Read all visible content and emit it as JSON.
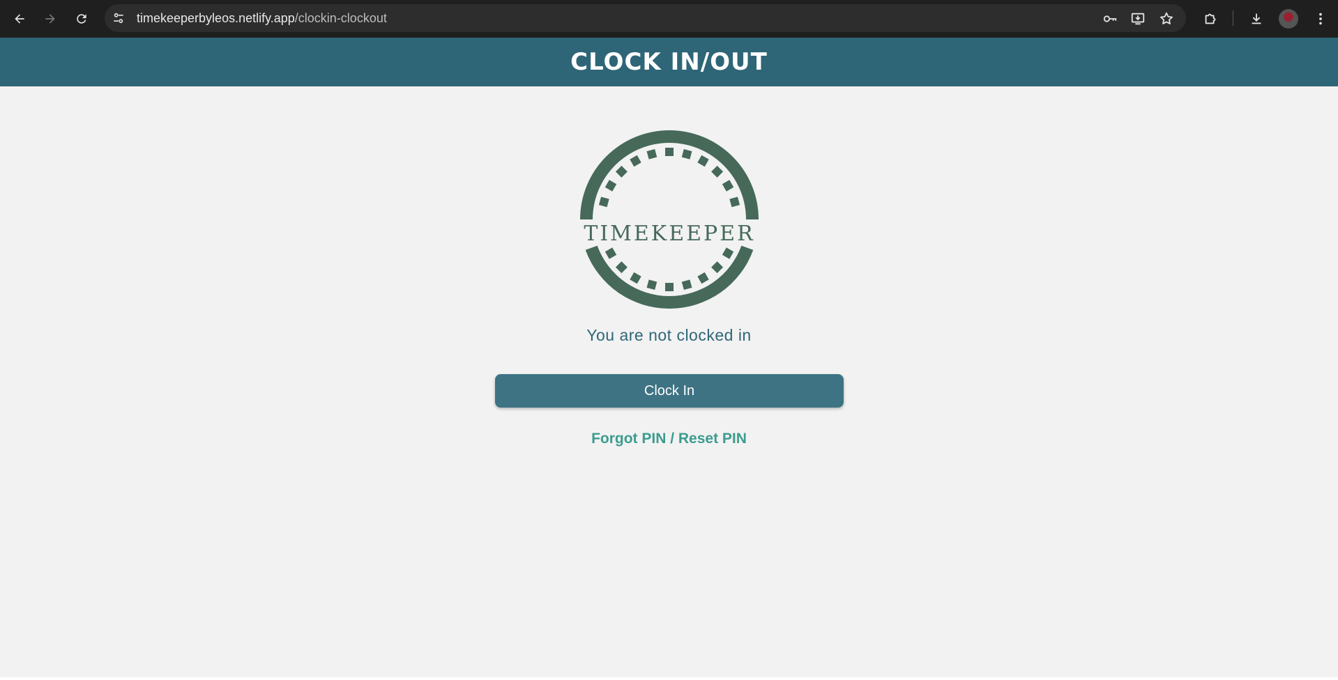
{
  "browser": {
    "url_host": "timekeeperbyleos.netlify.app",
    "url_path": "/clockin-clockout",
    "back_icon": "arrow-left-icon",
    "forward_icon": "arrow-right-icon",
    "reload_icon": "reload-icon",
    "site_info_icon": "tune-icon",
    "password_icon": "key-icon",
    "install_icon": "install-app-icon",
    "bookmark_icon": "star-icon",
    "extensions_icon": "puzzle-icon",
    "downloads_icon": "download-icon",
    "menu_icon": "more-vert-icon"
  },
  "header": {
    "title": "CLOCK IN/OUT",
    "background": "#2e6677"
  },
  "logo": {
    "text": "TIMEKEEPER",
    "color": "#46695a"
  },
  "main": {
    "status": "You are not clocked in",
    "clock_button_label": "Clock In",
    "forgot_link_label": "Forgot PIN / Reset PIN"
  },
  "colors": {
    "button": "#3e7384",
    "link": "#3c9c8e",
    "page_bg": "#f2f2f2"
  }
}
